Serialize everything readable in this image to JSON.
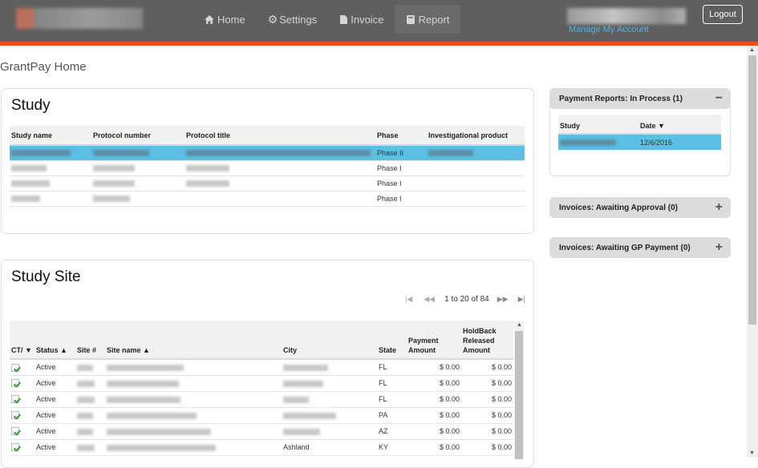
{
  "nav": {
    "items": [
      {
        "label": "Home",
        "icon": "home-icon"
      },
      {
        "label": "Settings",
        "icon": "gear-icon"
      },
      {
        "label": "Invoice",
        "icon": "document-icon"
      },
      {
        "label": "Report",
        "icon": "report-icon"
      }
    ],
    "active": "Report",
    "manage_account": "Manage My Account",
    "logout": "Logout"
  },
  "colors": {
    "header": "#5f5f5f",
    "accent_bar": "#e8501e",
    "selection": "#5bc0e4",
    "link": "#4db3e6"
  },
  "page": {
    "title": "GrantPay Home"
  },
  "study": {
    "title": "Study",
    "columns": [
      "Study name",
      "Protocol number",
      "Protocol title",
      "Phase",
      "Investigational product"
    ],
    "rows": [
      {
        "phase": "Phase II",
        "selected": true
      },
      {
        "phase": "Phase I",
        "selected": false
      },
      {
        "phase": "Phase I",
        "selected": false
      },
      {
        "phase": "Phase I",
        "selected": false
      }
    ]
  },
  "study_site": {
    "title": "Study Site",
    "pager": {
      "text": "1 to 20 of 84"
    },
    "columns": {
      "ct": "CT/ ▼",
      "status": "Status ▲",
      "site_no": "Site #",
      "site_name": "Site name ▲",
      "city": "City",
      "state": "State",
      "payment": "Payment Amount",
      "holdback": "HoldBack Released Amount"
    },
    "rows": [
      {
        "status": "Active",
        "city": "",
        "state": "FL",
        "payment": "$ 0.00",
        "holdback": "$ 0.00"
      },
      {
        "status": "Active",
        "city": "",
        "state": "FL",
        "payment": "$ 0.00",
        "holdback": "$ 0.00"
      },
      {
        "status": "Active",
        "city": "",
        "state": "FL",
        "payment": "$ 0.00",
        "holdback": "$ 0.00"
      },
      {
        "status": "Active",
        "city": "",
        "state": "PA",
        "payment": "$ 0.00",
        "holdback": "$ 0.00"
      },
      {
        "status": "Active",
        "city": "",
        "state": "AZ",
        "payment": "$ 0.00",
        "holdback": "$ 0.00"
      },
      {
        "status": "Active",
        "city": "Ashland",
        "state": "KY",
        "payment": "$ 0.00",
        "holdback": "$ 0.00"
      }
    ]
  },
  "sidebar": {
    "reports": {
      "title": "Payment Reports: In Process (1)",
      "toggle": "−",
      "columns": [
        "Study",
        "Date ▼"
      ],
      "rows": [
        {
          "date": "12/6/2016"
        }
      ]
    },
    "awaiting_approval": {
      "title": "Invoices: Awaiting Approval (0)",
      "toggle": "+"
    },
    "awaiting_gp": {
      "title": "Invoices: Awaiting GP Payment (0)",
      "toggle": "+"
    }
  }
}
